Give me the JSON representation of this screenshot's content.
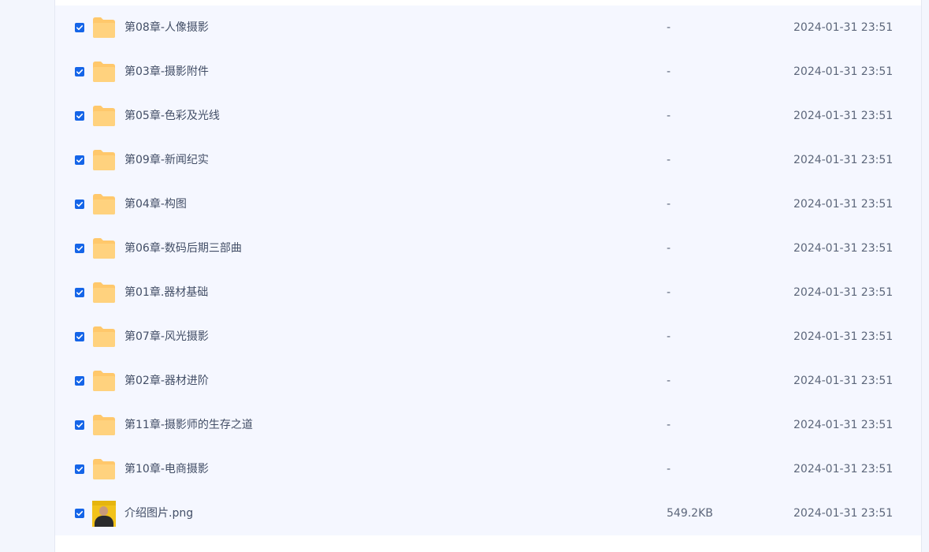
{
  "file_list": {
    "rows": [
      {
        "name": "第08章-人像摄影",
        "size": "-",
        "date": "2024-01-31 23:51",
        "checked": true,
        "icon": "folder-icon"
      },
      {
        "name": "第03章-摄影附件",
        "size": "-",
        "date": "2024-01-31 23:51",
        "checked": true,
        "icon": "folder-icon"
      },
      {
        "name": "第05章-色彩及光线",
        "size": "-",
        "date": "2024-01-31 23:51",
        "checked": true,
        "icon": "folder-icon"
      },
      {
        "name": "第09章-新闻纪实",
        "size": "-",
        "date": "2024-01-31 23:51",
        "checked": true,
        "icon": "folder-icon"
      },
      {
        "name": "第04章-构图",
        "size": "-",
        "date": "2024-01-31 23:51",
        "checked": true,
        "icon": "folder-icon"
      },
      {
        "name": "第06章-数码后期三部曲",
        "size": "-",
        "date": "2024-01-31 23:51",
        "checked": true,
        "icon": "folder-icon"
      },
      {
        "name": "第01章.器材基础",
        "size": "-",
        "date": "2024-01-31 23:51",
        "checked": true,
        "icon": "folder-icon"
      },
      {
        "name": "第07章-风光摄影",
        "size": "-",
        "date": "2024-01-31 23:51",
        "checked": true,
        "icon": "folder-icon"
      },
      {
        "name": "第02章-器材进阶",
        "size": "-",
        "date": "2024-01-31 23:51",
        "checked": true,
        "icon": "folder-icon"
      },
      {
        "name": "第11章-摄影师的生存之道",
        "size": "-",
        "date": "2024-01-31 23:51",
        "checked": true,
        "icon": "folder-icon"
      },
      {
        "name": "第10章-电商摄影",
        "size": "-",
        "date": "2024-01-31 23:51",
        "checked": true,
        "icon": "folder-icon"
      },
      {
        "name": "介绍图片.png",
        "size": "549.2KB",
        "date": "2024-01-31 23:51",
        "checked": true,
        "icon": "image-thumbnail-icon"
      }
    ]
  },
  "colors": {
    "checkbox": "#1565e8",
    "folder": "#ffc86b",
    "row_background": "#f5f7ff"
  }
}
